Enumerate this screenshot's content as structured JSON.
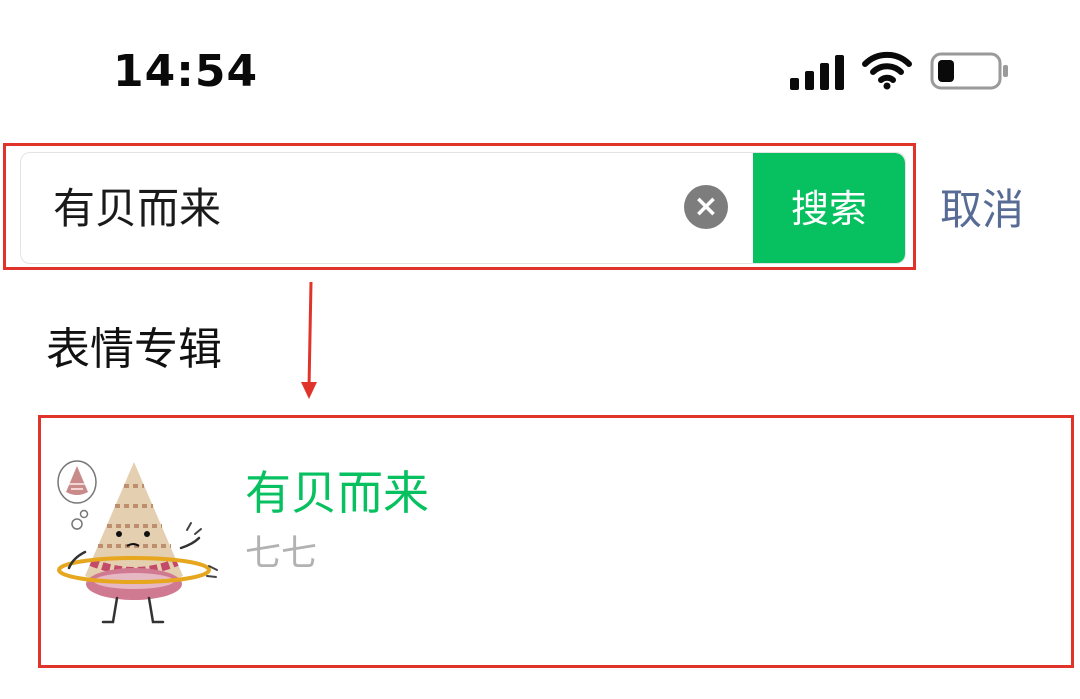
{
  "status_bar": {
    "time": "14:54",
    "icons": [
      "signal-icon",
      "wifi-icon",
      "battery-icon"
    ]
  },
  "search": {
    "query": "有贝而来",
    "button_label": "搜索",
    "cancel_label": "取消",
    "clear_glyph": "×"
  },
  "section": {
    "title": "表情专辑"
  },
  "results": [
    {
      "title": "有贝而来",
      "author": "七七",
      "image": "shell-character-sticker"
    }
  ],
  "colors": {
    "accent_green": "#07c160",
    "link_blue": "#576b95",
    "annotation_red": "#e0342a",
    "secondary_text": "#b2b2b2"
  }
}
